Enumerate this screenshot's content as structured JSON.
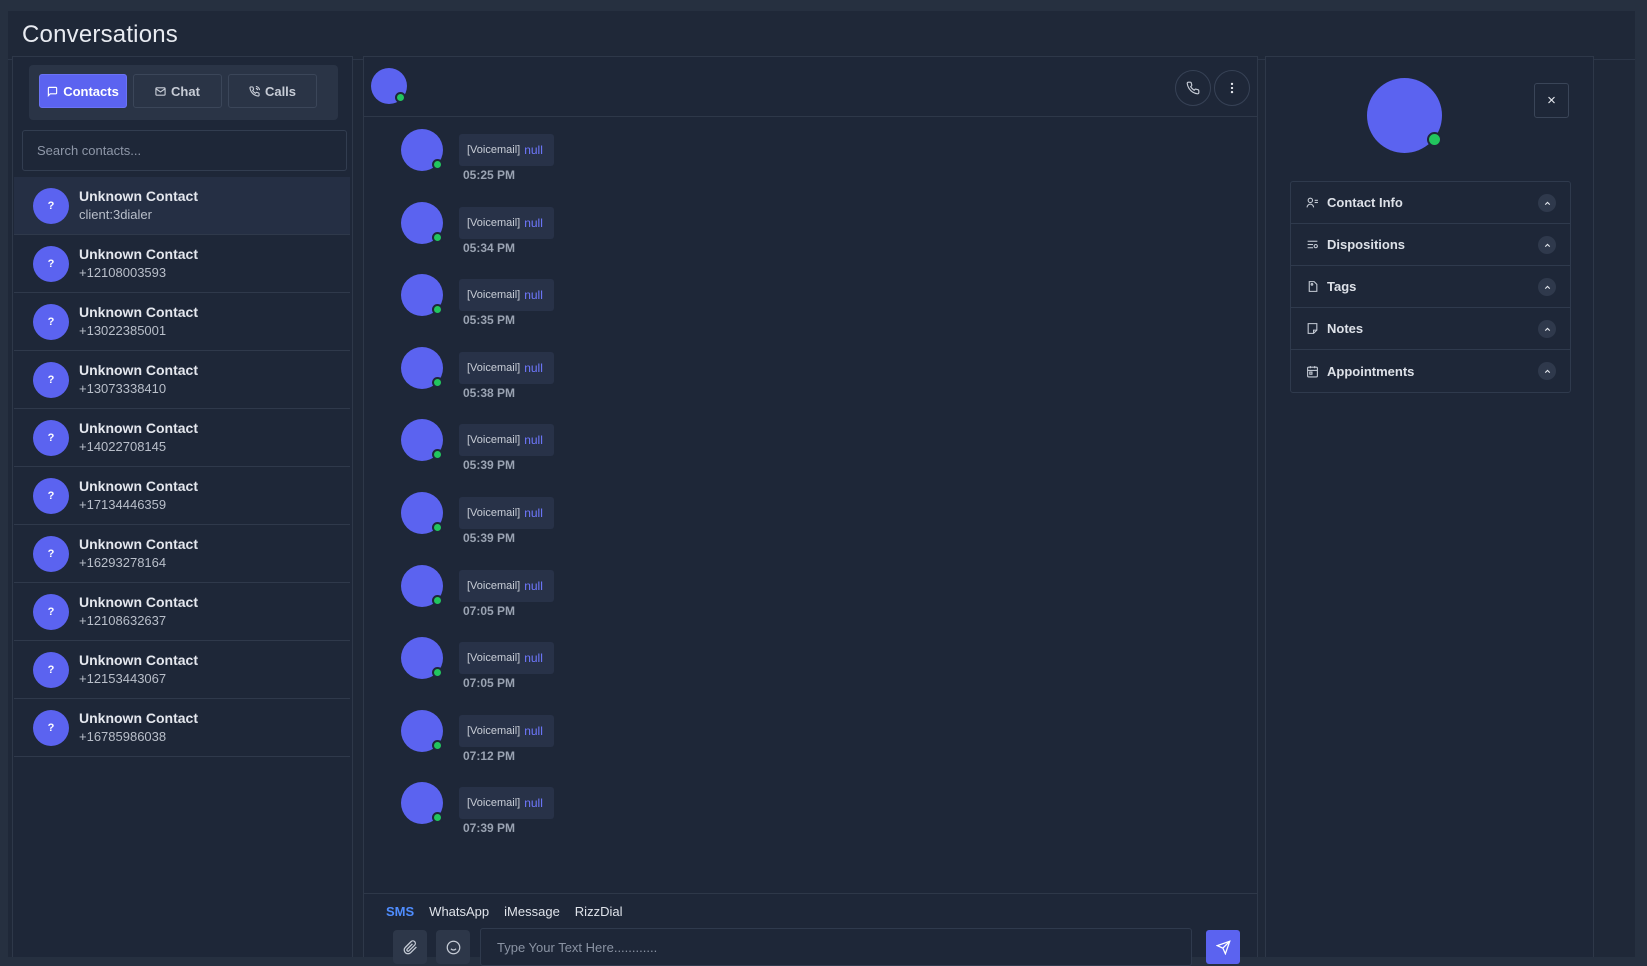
{
  "page": {
    "title": "Conversations"
  },
  "left": {
    "tabs": [
      {
        "label": "Contacts",
        "icon": "message-square-icon",
        "active": true
      },
      {
        "label": "Chat",
        "icon": "mail-icon",
        "active": false
      },
      {
        "label": "Calls",
        "icon": "phone-call-icon",
        "active": false
      }
    ],
    "search_placeholder": "Search contacts...",
    "contacts": [
      {
        "initial": "?",
        "name": "Unknown Contact",
        "sub": "client:3dialer",
        "selected": true
      },
      {
        "initial": "?",
        "name": "Unknown Contact",
        "sub": "+12108003593"
      },
      {
        "initial": "?",
        "name": "Unknown Contact",
        "sub": "+13022385001"
      },
      {
        "initial": "?",
        "name": "Unknown Contact",
        "sub": "+13073338410"
      },
      {
        "initial": "?",
        "name": "Unknown Contact",
        "sub": "+14022708145"
      },
      {
        "initial": "?",
        "name": "Unknown Contact",
        "sub": "+17134446359"
      },
      {
        "initial": "?",
        "name": "Unknown Contact",
        "sub": "+16293278164"
      },
      {
        "initial": "?",
        "name": "Unknown Contact",
        "sub": "+12108632637"
      },
      {
        "initial": "?",
        "name": "Unknown Contact",
        "sub": "+12153443067"
      },
      {
        "initial": "?",
        "name": "Unknown Contact",
        "sub": "+16785986038"
      }
    ]
  },
  "chat": {
    "header_icons": [
      "phone-icon",
      "more-vertical-icon"
    ],
    "messages": [
      {
        "tag": "[Voicemail]",
        "body": "null",
        "time": "05:25 PM"
      },
      {
        "tag": "[Voicemail]",
        "body": "null",
        "time": "05:34 PM"
      },
      {
        "tag": "[Voicemail]",
        "body": "null",
        "time": "05:35 PM"
      },
      {
        "tag": "[Voicemail]",
        "body": "null",
        "time": "05:38 PM"
      },
      {
        "tag": "[Voicemail]",
        "body": "null",
        "time": "05:39 PM"
      },
      {
        "tag": "[Voicemail]",
        "body": "null",
        "time": "05:39 PM"
      },
      {
        "tag": "[Voicemail]",
        "body": "null",
        "time": "07:05 PM"
      },
      {
        "tag": "[Voicemail]",
        "body": "null",
        "time": "07:05 PM"
      },
      {
        "tag": "[Voicemail]",
        "body": "null",
        "time": "07:12 PM"
      },
      {
        "tag": "[Voicemail]",
        "body": "null",
        "time": "07:39 PM"
      }
    ],
    "channels": [
      {
        "label": "SMS",
        "active": true
      },
      {
        "label": "WhatsApp"
      },
      {
        "label": "iMessage"
      },
      {
        "label": "RizzDial"
      }
    ],
    "input_placeholder": "Type Your Text Here............",
    "composer_icons": [
      "paperclip-icon",
      "smile-icon",
      "send-icon"
    ]
  },
  "details": {
    "close_label": "×",
    "sections": [
      {
        "label": "Contact Info",
        "icon": "user-list-icon"
      },
      {
        "label": "Dispositions",
        "icon": "list-filter-icon"
      },
      {
        "label": "Tags",
        "icon": "tag-icon"
      },
      {
        "label": "Notes",
        "icon": "sticky-note-icon"
      },
      {
        "label": "Appointments",
        "icon": "calendar-icon"
      }
    ]
  },
  "colors": {
    "accent": "#5b63f0",
    "online": "#22c55e",
    "link": "#6f78ff",
    "active_channel": "#4f8dff",
    "bg": "#1e2738"
  }
}
